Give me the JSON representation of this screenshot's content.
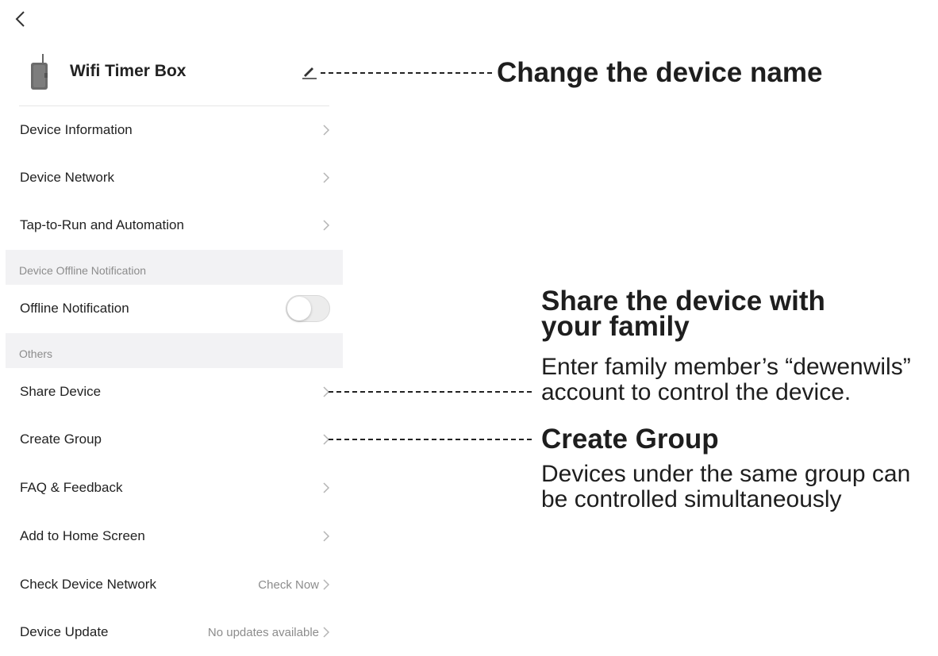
{
  "device": {
    "name": "Wifi Timer Box"
  },
  "menu": {
    "items_top": [
      {
        "label": "Device Information"
      },
      {
        "label": "Device Network"
      },
      {
        "label": "Tap-to-Run and Automation"
      }
    ],
    "section_offline": {
      "title": "Device Offline Notification"
    },
    "offline_notification": {
      "label": "Offline Notification",
      "enabled": false
    },
    "section_others": {
      "title": "Others"
    },
    "items_others": [
      {
        "label": "Share Device"
      },
      {
        "label": "Create Group"
      },
      {
        "label": "FAQ & Feedback"
      },
      {
        "label": "Add to Home Screen"
      },
      {
        "label": "Check Device Network",
        "value": "Check Now"
      },
      {
        "label": "Device Update",
        "value": "No updates available"
      }
    ]
  },
  "annotations": {
    "change_name": "Change the device name",
    "share_title_line1": "Share the device with",
    "share_title_line2": "your family",
    "share_desc_line1": "Enter family member’s “dewenwils”",
    "share_desc_line2": "account to control the device.",
    "group_title": "Create Group",
    "group_desc_line1": "Devices under the same group can",
    "group_desc_line2": "be controlled simultaneously"
  }
}
